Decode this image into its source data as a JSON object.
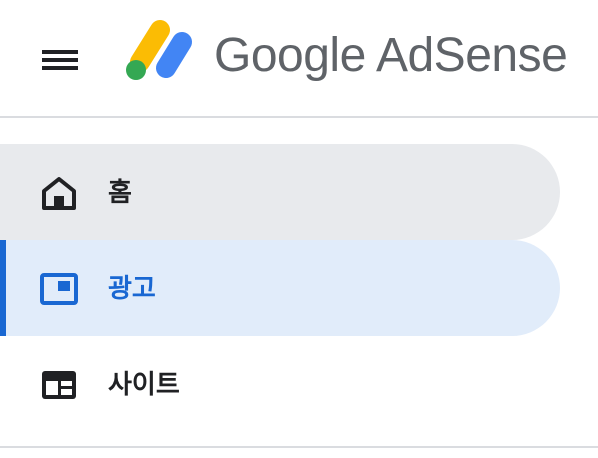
{
  "header": {
    "brand_name": "Google AdSense",
    "menu_icon": "hamburger-menu-icon",
    "logo_icon": "adsense-logo-icon"
  },
  "nav": {
    "items": [
      {
        "label": "홈",
        "icon": "home-icon",
        "state": "hover"
      },
      {
        "label": "광고",
        "icon": "ads-icon",
        "state": "active"
      },
      {
        "label": "사이트",
        "icon": "sites-icon",
        "state": "normal"
      }
    ]
  },
  "colors": {
    "active_accent": "#1967d2",
    "active_bg": "#e1ecfa",
    "hover_bg": "#e8eaed",
    "logo_yellow": "#fbbc04",
    "logo_blue": "#4285f4",
    "logo_green": "#34a853"
  }
}
